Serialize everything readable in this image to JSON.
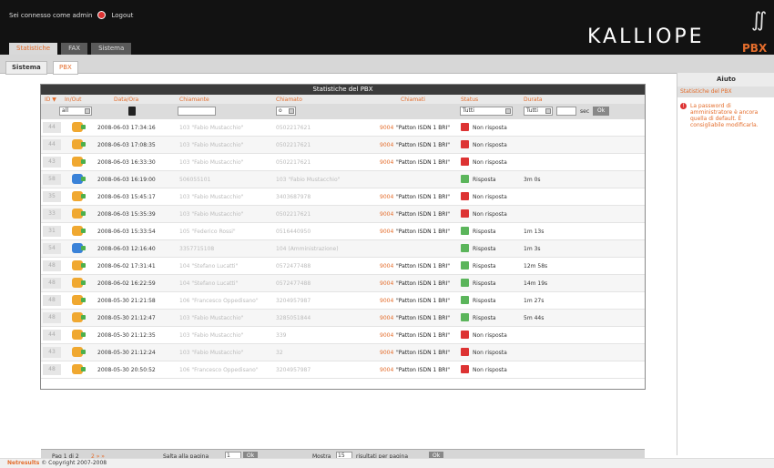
{
  "user": {
    "text": "Sei connesso come admin",
    "logout": "Logout"
  },
  "main_tabs": [
    {
      "label": "Statistiche",
      "active": true
    },
    {
      "label": "FAX",
      "active": false
    },
    {
      "label": "Sistema",
      "active": false
    }
  ],
  "logo": {
    "brand": "KALLIOPE",
    "sub": "PBX"
  },
  "sub_tabs": [
    {
      "label": "Sistema",
      "active": false
    },
    {
      "label": "PBX",
      "active": true
    }
  ],
  "help": {
    "title": "Aiuto",
    "subtitle": "Statistiche del PBX",
    "message": "La password di amministratore è ancora quella di default. È consigliabile modificarla."
  },
  "panel_title": "Statistiche del PBX",
  "columns": {
    "id": "ID ▼",
    "dir": "In/Out",
    "date": "Data/Ora",
    "caller": "Chiamante",
    "called": "Chiamato",
    "trunk": "Chiamati",
    "status": "Status",
    "duration": "Durata"
  },
  "filters": {
    "dir": "all",
    "called": "o",
    "status": "Tutti",
    "duration": "Tutti",
    "sec": "sec",
    "ok": "Ok"
  },
  "rows": [
    {
      "id": "44",
      "dir": "out",
      "date": "2008-06-03 17:34:16",
      "caller": "103 \"Fabio Mustacchio\"",
      "called": "0502217621",
      "prefix": "9004",
      "trunk": "\"Patton ISDN 1 BRI\"",
      "status": "Non risposta",
      "ok": false,
      "duration": ""
    },
    {
      "id": "44",
      "dir": "out",
      "date": "2008-06-03 17:08:35",
      "caller": "103 \"Fabio Mustacchio\"",
      "called": "0502217621",
      "prefix": "9004",
      "trunk": "\"Patton ISDN 1 BRI\"",
      "status": "Non risposta",
      "ok": false,
      "duration": ""
    },
    {
      "id": "43",
      "dir": "out",
      "date": "2008-06-03 16:33:30",
      "caller": "103 \"Fabio Mustacchio\"",
      "called": "0502217621",
      "prefix": "9004",
      "trunk": "\"Patton ISDN 1 BRI\"",
      "status": "Non risposta",
      "ok": false,
      "duration": ""
    },
    {
      "id": "58",
      "dir": "in",
      "date": "2008-06-03 16:19:00",
      "caller": "506055101",
      "called": "103 \"Fabio Mustacchio\"",
      "prefix": "",
      "trunk": "",
      "status": "Risposta",
      "ok": true,
      "duration": "3m 0s"
    },
    {
      "id": "35",
      "dir": "out",
      "date": "2008-06-03 15:45:17",
      "caller": "103 \"Fabio Mustacchio\"",
      "called": "3403687978",
      "prefix": "9004",
      "trunk": "\"Patton ISDN 1 BRI\"",
      "status": "Non risposta",
      "ok": false,
      "duration": ""
    },
    {
      "id": "33",
      "dir": "out",
      "date": "2008-06-03 15:35:39",
      "caller": "103 \"Fabio Mustacchio\"",
      "called": "0502217621",
      "prefix": "9004",
      "trunk": "\"Patton ISDN 1 BRI\"",
      "status": "Non risposta",
      "ok": false,
      "duration": ""
    },
    {
      "id": "31",
      "dir": "out",
      "date": "2008-06-03 15:33:54",
      "caller": "105 \"Federico Rossi\"",
      "called": "0516440950",
      "prefix": "9004",
      "trunk": "\"Patton ISDN 1 BRI\"",
      "status": "Risposta",
      "ok": true,
      "duration": "1m 13s"
    },
    {
      "id": "54",
      "dir": "in",
      "date": "2008-06-03 12:16:40",
      "caller": "3357715108",
      "called": "104 (Amministrazione)",
      "prefix": "",
      "trunk": "",
      "status": "Risposta",
      "ok": true,
      "duration": "1m 3s"
    },
    {
      "id": "48",
      "dir": "out",
      "date": "2008-06-02 17:31:41",
      "caller": "104 \"Stefano Lucatti\"",
      "called": "0572477488",
      "prefix": "9004",
      "trunk": "\"Patton ISDN 1 BRI\"",
      "status": "Risposta",
      "ok": true,
      "duration": "12m 58s"
    },
    {
      "id": "48",
      "dir": "out",
      "date": "2008-06-02 16:22:59",
      "caller": "104 \"Stefano Lucatti\"",
      "called": "0572477488",
      "prefix": "9004",
      "trunk": "\"Patton ISDN 1 BRI\"",
      "status": "Risposta",
      "ok": true,
      "duration": "14m 19s"
    },
    {
      "id": "48",
      "dir": "out",
      "date": "2008-05-30 21:21:58",
      "caller": "106 \"Francesco Oppedisano\"",
      "called": "3204957987",
      "prefix": "9004",
      "trunk": "\"Patton ISDN 1 BRI\"",
      "status": "Risposta",
      "ok": true,
      "duration": "1m 27s"
    },
    {
      "id": "48",
      "dir": "out",
      "date": "2008-05-30 21:12:47",
      "caller": "103 \"Fabio Mustacchio\"",
      "called": "3285051844",
      "prefix": "9004",
      "trunk": "\"Patton ISDN 1 BRI\"",
      "status": "Risposta",
      "ok": true,
      "duration": "5m 44s"
    },
    {
      "id": "44",
      "dir": "out",
      "date": "2008-05-30 21:12:35",
      "caller": "103 \"Fabio Mustacchio\"",
      "called": "339",
      "prefix": "9004",
      "trunk": "\"Patton ISDN 1 BRI\"",
      "status": "Non risposta",
      "ok": false,
      "duration": ""
    },
    {
      "id": "43",
      "dir": "out",
      "date": "2008-05-30 21:12:24",
      "caller": "103 \"Fabio Mustacchio\"",
      "called": "32",
      "prefix": "9004",
      "trunk": "\"Patton ISDN 1 BRI\"",
      "status": "Non risposta",
      "ok": false,
      "duration": ""
    },
    {
      "id": "48",
      "dir": "out",
      "date": "2008-05-30 20:50:52",
      "caller": "106 \"Francesco Oppedisano\"",
      "called": "3204957987",
      "prefix": "9004",
      "trunk": "\"Patton ISDN 1 BRI\"",
      "status": "Non risposta",
      "ok": false,
      "duration": ""
    }
  ],
  "pagination": {
    "label": "Pag 1 di 2",
    "goto": "Salta alla pagina",
    "page": "1",
    "ok": "Ok",
    "show": "Mostra",
    "per_page": "15",
    "results": "risultati per pagina"
  },
  "footer": {
    "brand": "Netresults",
    "copyright": "© Copyright 2007-2008"
  }
}
